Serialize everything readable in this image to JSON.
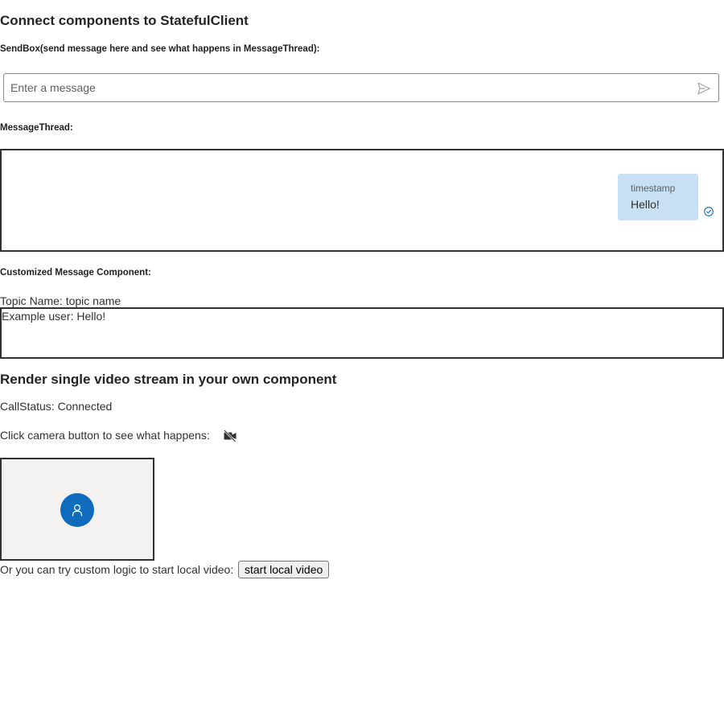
{
  "page": {
    "title": "Connect components to StatefulClient"
  },
  "sendbox": {
    "label": "SendBox(send message here and see what happens in MessageThread):",
    "placeholder": "Enter a message",
    "value": "",
    "send_icon": "send-icon"
  },
  "message_thread": {
    "label": "MessageThread:",
    "messages": [
      {
        "timestamp": "timestamp",
        "content": "Hello!",
        "status_icon": "delivered-check-icon"
      }
    ]
  },
  "custom_message": {
    "label": "Customized Message Component:",
    "topic_line": "Topic Name: topic name",
    "messages": [
      "Example user: Hello!"
    ]
  },
  "video": {
    "heading": "Render single video stream in your own component",
    "call_status": "CallStatus: Connected",
    "camera_prompt": "Click camera button to see what happens:",
    "camera_icon": "camera-off-icon",
    "avatar_icon": "person-icon",
    "custom_logic_prompt": "Or you can try custom logic to start local video:",
    "start_button_label": "start local video"
  },
  "colors": {
    "accent": "#0f6cbd",
    "bubble": "#c7e0f4",
    "tile_background": "#f3f2f1",
    "border": "#323130"
  }
}
